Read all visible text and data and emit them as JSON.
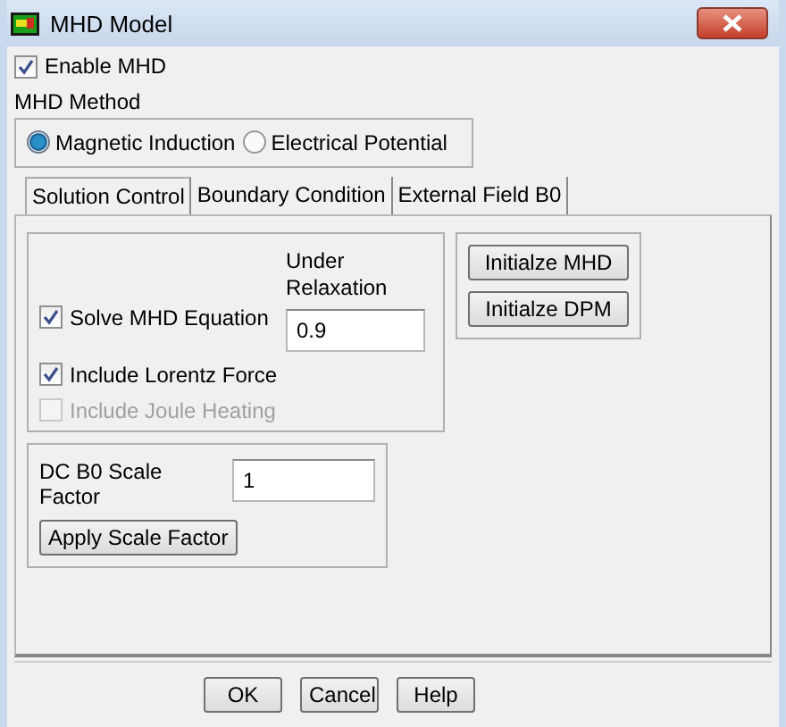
{
  "window": {
    "title": "MHD Model"
  },
  "enable_mhd": {
    "label": "Enable MHD",
    "checked": true
  },
  "mhd_method": {
    "label": "MHD Method",
    "options": [
      {
        "label": "Magnetic Induction",
        "selected": true
      },
      {
        "label": "Electrical Potential",
        "selected": false
      }
    ]
  },
  "tabs": [
    {
      "label": "Solution Control",
      "selected": true
    },
    {
      "label": "Boundary Condition",
      "selected": false
    },
    {
      "label": "External Field B0",
      "selected": false
    }
  ],
  "solution_control": {
    "options": [
      {
        "label": "Solve MHD Equation",
        "checked": true,
        "disabled": false
      },
      {
        "label": "Include Lorentz Force",
        "checked": true,
        "disabled": false
      },
      {
        "label": "Include Joule Heating",
        "checked": false,
        "disabled": true
      }
    ],
    "under_relaxation": {
      "label": "Under Relaxation",
      "value": "0.9"
    },
    "init_buttons": [
      "Initialze MHD",
      "Initialze DPM"
    ],
    "scale_factor": {
      "label": "DC B0 Scale Factor",
      "value": "1"
    },
    "apply_button": "Apply Scale Factor"
  },
  "buttons": [
    "OK",
    "Cancel",
    "Help"
  ]
}
